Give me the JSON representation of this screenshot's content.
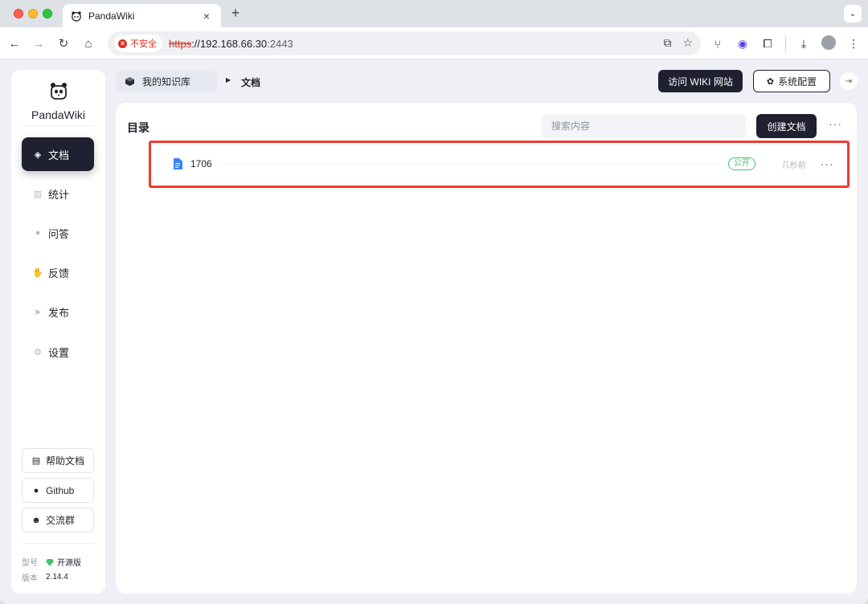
{
  "browser": {
    "tab_title": "PandaWiki",
    "tab_close": "×",
    "new_tab": "+",
    "insecure_label": "不安全",
    "url_scheme": "https",
    "url_host": "://192.168.66.30",
    "url_port": ":2443"
  },
  "sidebar": {
    "brand": "PandaWiki",
    "nav": [
      {
        "label": "文档",
        "icon": "layers-icon",
        "active": true
      },
      {
        "label": "统计",
        "icon": "bar-chart-icon"
      },
      {
        "label": "问答",
        "icon": "chat-bubble-icon"
      },
      {
        "label": "反馈",
        "icon": "hand-icon"
      },
      {
        "label": "发布",
        "icon": "send-icon"
      },
      {
        "label": "设置",
        "icon": "gear-icon"
      }
    ],
    "links": [
      {
        "label": "帮助文档",
        "icon": "document-icon"
      },
      {
        "label": "Github",
        "icon": "github-icon"
      },
      {
        "label": "交流群",
        "icon": "group-icon"
      }
    ],
    "model_label": "型号",
    "model_value": "开源版",
    "version_label": "版本",
    "version_value": "2.14.4"
  },
  "header": {
    "breadcrumb_root": "我的知识库",
    "breadcrumb_current": "文档",
    "visit_wiki": "访问 WIKI 网站",
    "system_config": "系统配置"
  },
  "main": {
    "title": "目录",
    "search_placeholder": "搜索内容",
    "create_label": "创建文档",
    "documents": [
      {
        "name": "1706",
        "status": "公开",
        "time": "几秒前"
      }
    ]
  },
  "colors": {
    "accent_dark": "#1f2030",
    "highlight_red": "#f03a2f",
    "public_green": "#46c46e",
    "doc_blue": "#3b82f6"
  }
}
